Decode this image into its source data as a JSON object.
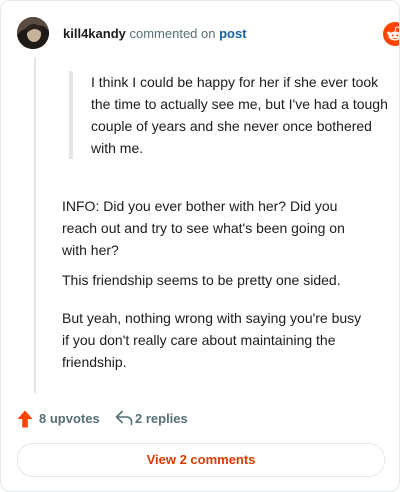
{
  "comment": {
    "username": "kill4kandy",
    "action_text": " commented on ",
    "post_link": "post",
    "quote": "I think I could be happy for her if she ever took the time to actually see me, but I've had a tough couple of years and she never once bothered with me.",
    "paragraphs": [
      "INFO: Did you ever bother with her? Did you reach out and try to see what's been going on with her?",
      "This friendship seems to be pretty one sided.",
      "But yeah, nothing wrong with saying you're busy if you don't really care about maintaining the friendship."
    ]
  },
  "brand": {
    "name": "reddit",
    "icon": "reddit-snoo-icon",
    "color": "#ff4500"
  },
  "actions": {
    "upvotes_label": "8 upvotes",
    "replies_label": "2 replies",
    "upvote_icon": "upvote-arrow-icon",
    "reply_icon": "reply-arrow-icon"
  },
  "footer": {
    "view_comments_label": "View 2 comments"
  },
  "colors": {
    "accent": "#d93a00",
    "upvote": "#ff4500",
    "link": "#1a5f9e",
    "muted": "#576f76"
  }
}
